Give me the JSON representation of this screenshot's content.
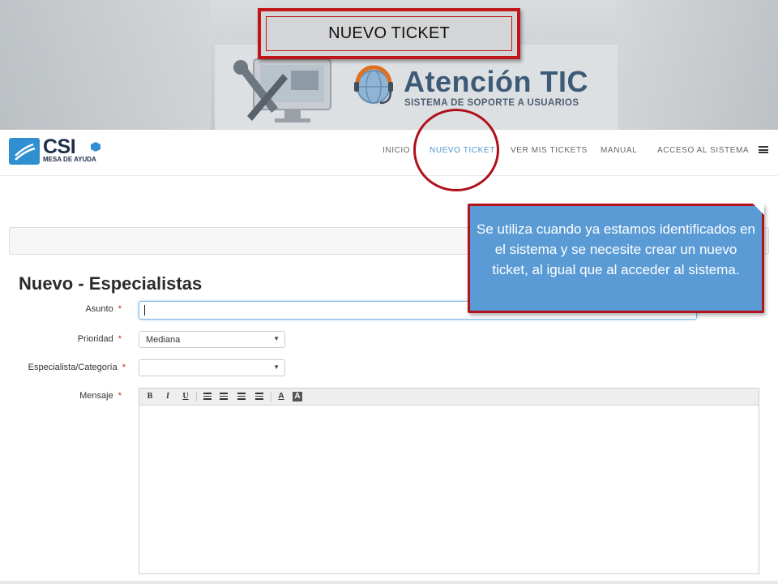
{
  "banner": {
    "title": "NUEVO TICKET",
    "heading": "Atención TIC",
    "subheading": "SISTEMA DE SOPORTE A USUARIOS"
  },
  "navbar": {
    "brand_name": "CSI",
    "brand_sub": "MESA DE AYUDA",
    "items": [
      {
        "label": "INICIO"
      },
      {
        "label": "NUEVO TICKET"
      },
      {
        "label": "VER MIS TICKETS"
      },
      {
        "label": "MANUAL"
      },
      {
        "label": "ACCESO AL SISTEMA"
      }
    ],
    "active_item": "NUEVO TICKET",
    "menu_icon": "hamburger-icon"
  },
  "callout": {
    "text": "Se utiliza cuando ya estamos identificados en el sistema y se necesite crear un nuevo ticket, al igual que al acceder al sistema."
  },
  "form": {
    "title": "Nuevo - Especialistas",
    "required_mark": "*",
    "fields": {
      "asunto": {
        "label": "Asunto",
        "value": ""
      },
      "prioridad": {
        "label": "Prioridad",
        "value": "Mediana"
      },
      "especialista": {
        "label": "Especialista/Categoría",
        "value": ""
      },
      "mensaje": {
        "label": "Mensaje",
        "value": ""
      }
    },
    "editor_toolbar": [
      "bold",
      "italic",
      "underline",
      "bullet-list",
      "numbered-list",
      "outdent",
      "indent",
      "text-color",
      "background-color"
    ],
    "toolbar_glyphs": {
      "bold": "B",
      "italic": "I",
      "underline": "U",
      "text_color": "A",
      "bg_color": "A"
    }
  },
  "colors": {
    "accent": "#4b98c9",
    "callout_bg": "#5a9bd5",
    "highlight_red": "#b3141c",
    "required": "#d0201a"
  }
}
